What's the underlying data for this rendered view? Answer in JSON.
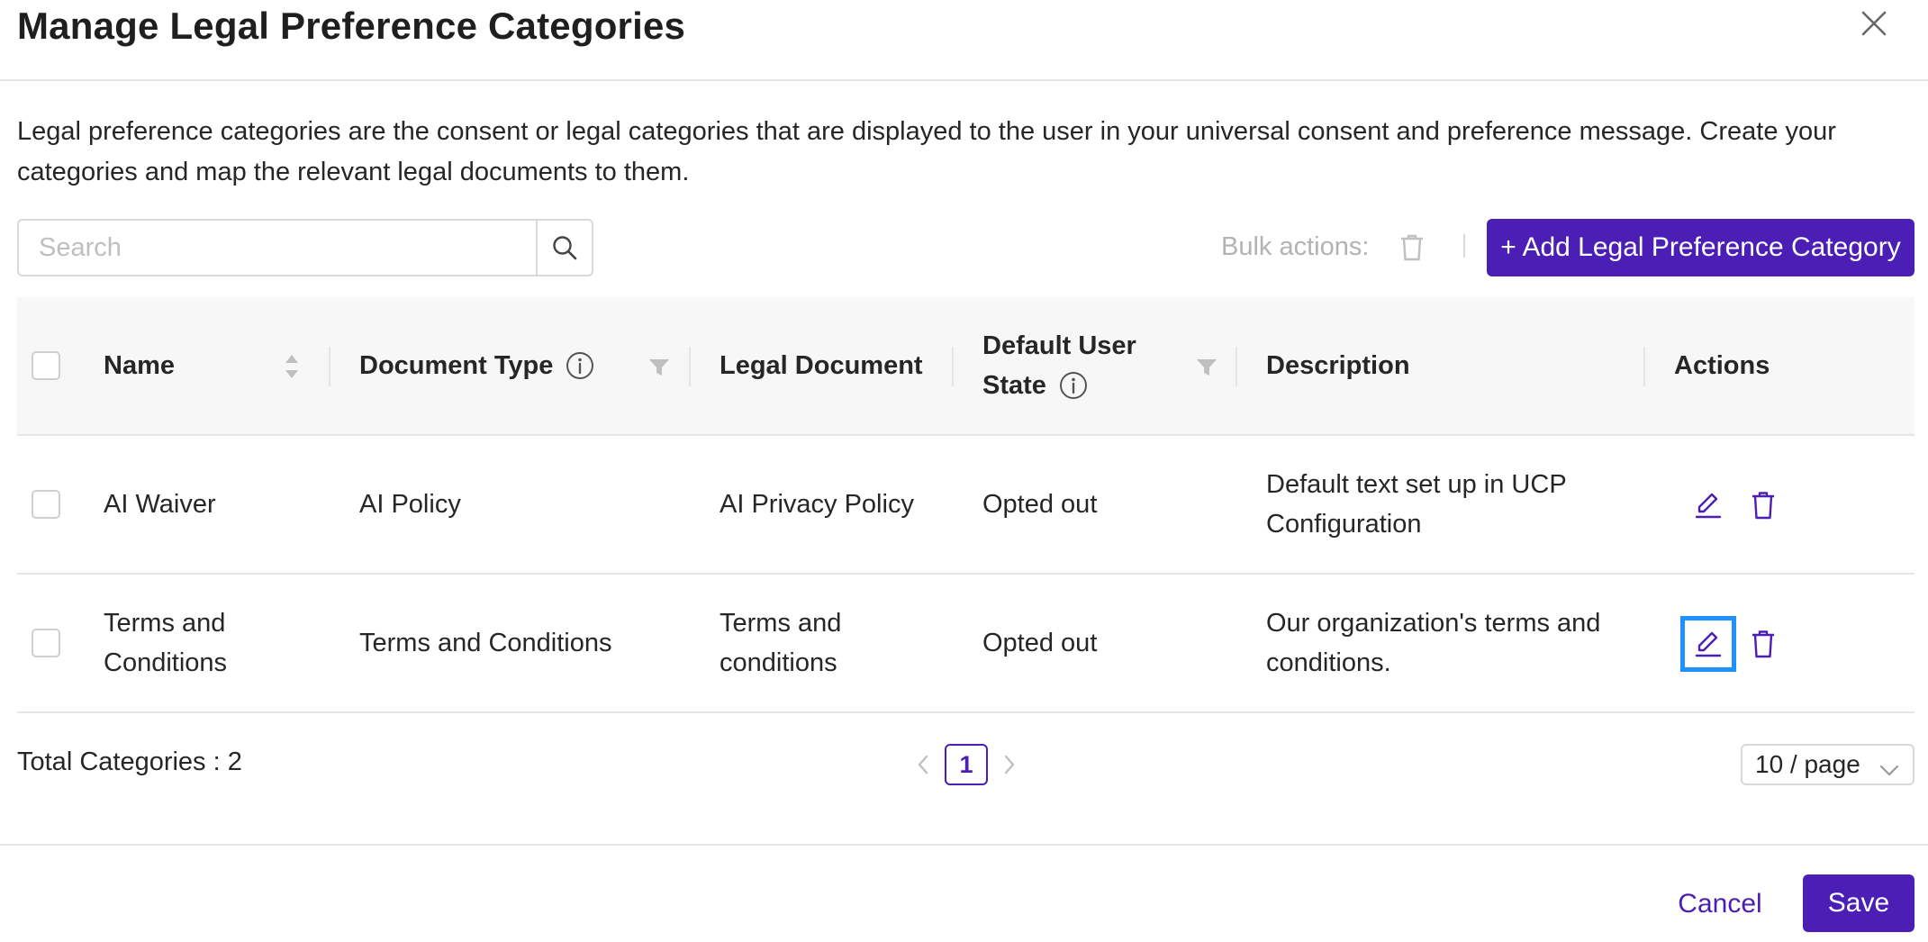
{
  "dialog": {
    "title": "Manage Legal Preference Categories",
    "intro": "Legal preference categories are the consent or legal categories that are displayed to the user in your universal consent and preference message. Create your categories and map the relevant legal documents to them."
  },
  "toolbar": {
    "search_placeholder": "Search",
    "bulk_actions_label": "Bulk actions:",
    "add_button_label": "+ Add Legal Preference Category"
  },
  "table": {
    "columns": {
      "name": "Name",
      "document_type": "Document Type",
      "legal_document": "Legal Document",
      "default_user_state_line1": "Default User",
      "default_user_state_line2": "State",
      "description": "Description",
      "actions": "Actions"
    },
    "rows": [
      {
        "name": "AI Waiver",
        "document_type": "AI Policy",
        "legal_document": "AI Privacy Policy",
        "default_user_state": "Opted out",
        "description_line1": "Default text set up in UCP",
        "description_line2": "Configuration"
      },
      {
        "name_line1": "Terms and",
        "name_line2": "Conditions",
        "document_type": "Terms and Conditions",
        "legal_document_line1": "Terms and",
        "legal_document_line2": "conditions",
        "default_user_state": "Opted out",
        "description_line1": "Our organization's terms and",
        "description_line2": "conditions."
      }
    ]
  },
  "pagination": {
    "total_label": "Total Categories : 2",
    "current_page": "1",
    "page_size": "10 / page"
  },
  "footer": {
    "cancel_label": "Cancel",
    "save_label": "Save"
  },
  "colors": {
    "accent": "#4b1fb5",
    "focus": "#1e90ff",
    "border": "#e6e6e6"
  }
}
